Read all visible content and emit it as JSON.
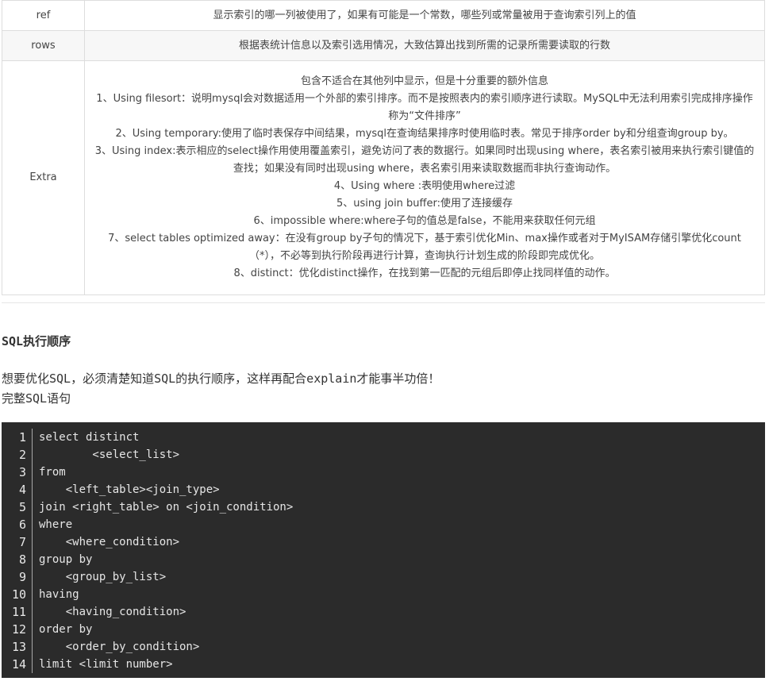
{
  "table": {
    "rows": [
      {
        "key": "ref",
        "value": "显示索引的哪一列被使用了，如果有可能是一个常数，哪些列或常量被用于查询索引列上的值"
      },
      {
        "key": "rows",
        "value": "根据表统计信息以及索引选用情况，大致估算出找到所需的记录所需要读取的行数"
      },
      {
        "key": "Extra",
        "lines": [
          "包含不适合在其他列中显示，但是十分重要的额外信息",
          "1、Using filesort：说明mysql会对数据适用一个外部的索引排序。而不是按照表内的索引顺序进行读取。MySQL中无法利用索引完成排序操作称为“文件排序”",
          "2、Using temporary:使用了临时表保存中间结果，mysql在查询结果排序时使用临时表。常见于排序order by和分组查询group by。",
          "3、Using index:表示相应的select操作用使用覆盖索引，避免访问了表的数据行。如果同时出现using where，表名索引被用来执行索引键值的查找；如果没有同时出现using where，表名索引用来读取数据而非执行查询动作。",
          "4、Using where :表明使用where过滤",
          "5、using join buffer:使用了连接缓存",
          "6、impossible where:where子句的值总是false，不能用来获取任何元组",
          "7、select tables optimized away：在没有group by子句的情况下，基于索引优化Min、max操作或者对于MyISAM存储引擎优化count（*），不必等到执行阶段再进行计算，查询执行计划生成的阶段即完成优化。",
          "8、distinct：优化distinct操作，在找到第一匹配的元组后即停止找同样值的动作。"
        ]
      }
    ]
  },
  "section": {
    "heading": "SQL执行顺序",
    "paragraph_lines": [
      "想要优化SQL，必须清楚知道SQL的执行顺序，这样再配合explain才能事半功倍！",
      "完整SQL语句"
    ]
  },
  "code": {
    "lines": [
      {
        "n": "1",
        "text": "select distinct"
      },
      {
        "n": "2",
        "text": "        <select_list>"
      },
      {
        "n": "3",
        "text": "from"
      },
      {
        "n": "4",
        "text": "    <left_table><join_type>"
      },
      {
        "n": "5",
        "text": "join <right_table> on <join_condition>"
      },
      {
        "n": "6",
        "text": "where"
      },
      {
        "n": "7",
        "text": "    <where_condition>"
      },
      {
        "n": "8",
        "text": "group by"
      },
      {
        "n": "9",
        "text": "    <group_by_list>"
      },
      {
        "n": "10",
        "text": "having"
      },
      {
        "n": "11",
        "text": "    <having_condition>"
      },
      {
        "n": "12",
        "text": "order by"
      },
      {
        "n": "13",
        "text": "    <order_by_condition>"
      },
      {
        "n": "14",
        "text": "limit <limit number>"
      }
    ]
  }
}
